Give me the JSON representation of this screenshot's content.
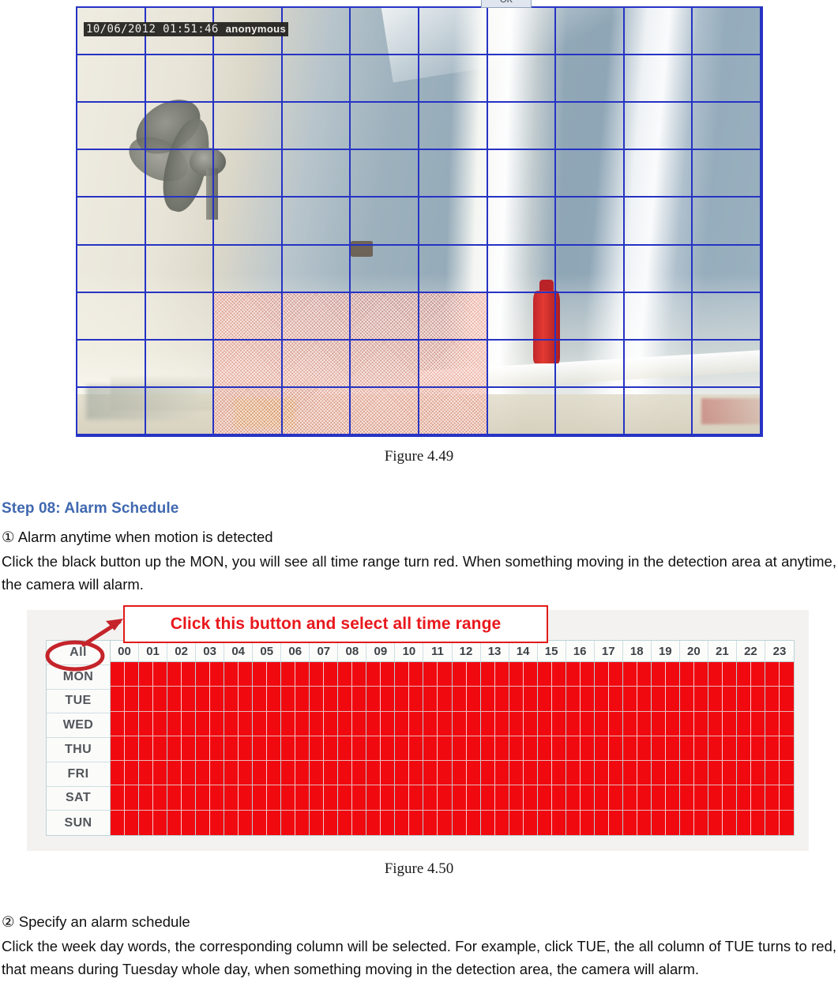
{
  "camera_figure": {
    "osd_timestamp": "10/06/2012 01:51:46",
    "osd_user": "anonymous",
    "ok_button_label": "OK",
    "grid": {
      "columns": 10,
      "rows": 9
    },
    "selected_region": {
      "col_start": 2,
      "col_end": 5,
      "row_start": 6,
      "row_end": 8
    },
    "grid_line_color": "#2633c4",
    "selection_color": "#e06046",
    "caption": "Figure 4.49"
  },
  "step": {
    "heading": "Step 08: Alarm Schedule",
    "heading_color": "#4068b0",
    "item1_marker": "①",
    "item1_title": "Alarm anytime when motion is detected",
    "item1_body": "Click the black button up the MON, you will see all time range turn red. When something moving in the detection area at anytime, the camera will alarm.",
    "item2_marker": "②",
    "item2_title": "Specify an alarm schedule",
    "item2_body": "Click the week day words, the corresponding column will be selected. For example, click TUE, the all column of TUE turns to red, that means during Tuesday whole day, when something moving in the detection area, the camera will alarm."
  },
  "schedule_figure": {
    "callout_text": "Click this button and select all time range",
    "callout_border_color": "#e11b1b",
    "callout_text_color": "#e8171c",
    "annotation_color": "#c4242a",
    "all_button_label": "All",
    "row_labels": [
      "All",
      "MON",
      "TUE",
      "WED",
      "THU",
      "FRI",
      "SAT",
      "SUN"
    ],
    "day_rows": [
      "MON",
      "TUE",
      "WED",
      "THU",
      "FRI",
      "SAT",
      "SUN"
    ],
    "hours": [
      "00",
      "01",
      "02",
      "03",
      "04",
      "05",
      "06",
      "07",
      "08",
      "09",
      "10",
      "11",
      "12",
      "13",
      "14",
      "15",
      "16",
      "17",
      "18",
      "19",
      "20",
      "21",
      "22",
      "23"
    ],
    "slots_per_hour": 2,
    "selected_color": "#f00a10",
    "all_selected": true,
    "caption": "Figure 4.50"
  }
}
